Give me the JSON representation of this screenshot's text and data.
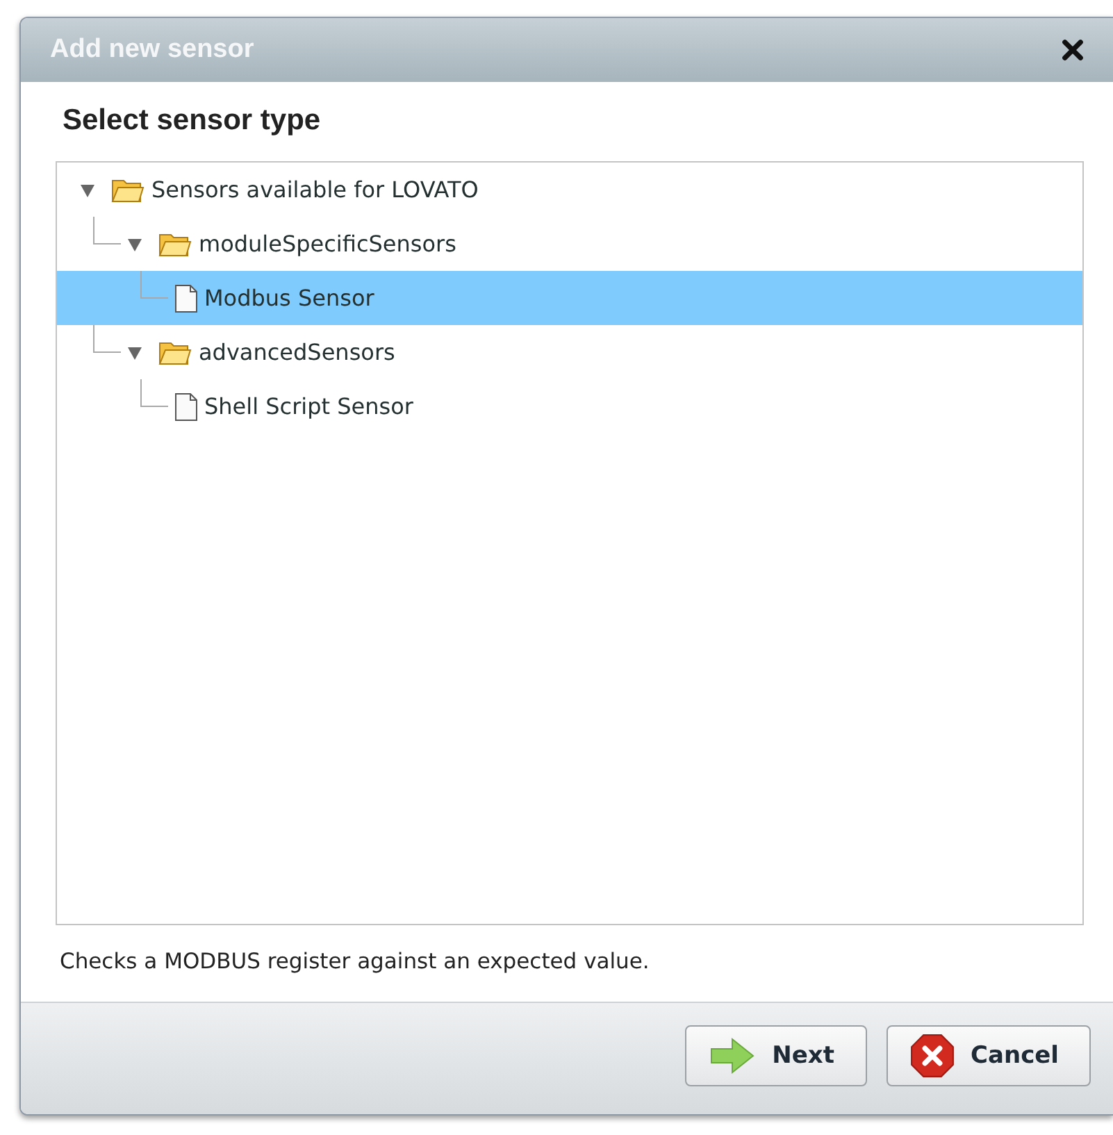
{
  "window": {
    "title": "Add new sensor"
  },
  "heading": "Select sensor type",
  "tree": [
    {
      "kind": "folder",
      "label": "Sensors available for LOVATO",
      "expanded": true,
      "selected": false,
      "children": [
        {
          "kind": "folder",
          "label": "moduleSpecificSensors",
          "expanded": true,
          "selected": false,
          "children": [
            {
              "kind": "file",
              "label": "Modbus Sensor",
              "selected": true
            }
          ]
        },
        {
          "kind": "folder",
          "label": "advancedSensors",
          "expanded": true,
          "selected": false,
          "children": [
            {
              "kind": "file",
              "label": "Shell Script Sensor",
              "selected": false
            }
          ]
        }
      ]
    }
  ],
  "description": "Checks a MODBUS register against an expected value.",
  "buttons": [
    {
      "kind": "next",
      "label": "Next"
    },
    {
      "kind": "cancel",
      "label": "Cancel"
    }
  ]
}
